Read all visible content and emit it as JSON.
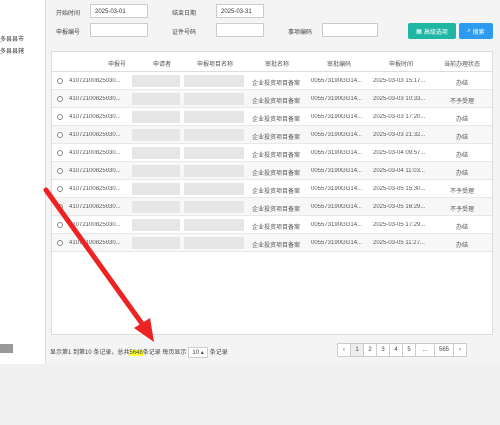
{
  "left_panel": {
    "items": [
      "多县县市",
      "多县县辖"
    ]
  },
  "filters": {
    "start_time_label": "开始时间",
    "start_time_value": "2025-03-01",
    "end_time_label": "结束日期",
    "end_time_value": "2025-03-31",
    "apply_no_label": "申报编号",
    "cert_no_label": "证件号码",
    "item_code_label": "事项编码",
    "advanced_button": "高级选项",
    "search_button": "搜索"
  },
  "table": {
    "headers": [
      "申报号",
      "申请者",
      "申报项目名称",
      "审批名称",
      "审批编码",
      "申报时间",
      "当前办理状态"
    ],
    "rows": [
      {
        "no": "41072100825030...",
        "approval": "企业投资项目备案",
        "code": "005573190GG14...",
        "time": "2025-03-03 15:17...",
        "status": "办结"
      },
      {
        "no": "41072100825030...",
        "approval": "企业投资项目备案",
        "code": "005573190GG14...",
        "time": "2025-03-03 10:33...",
        "status": "不予受理"
      },
      {
        "no": "41072100825030...",
        "approval": "企业投资项目备案",
        "code": "005573190GG14...",
        "time": "2025-03-03 17:20...",
        "status": "办结"
      },
      {
        "no": "41072100825030...",
        "approval": "企业投资项目备案",
        "code": "005573190GG14...",
        "time": "2025-03-03 21:32...",
        "status": "办结"
      },
      {
        "no": "41072100825030...",
        "approval": "企业投资项目备案",
        "code": "005573190GG14...",
        "time": "2025-03-04 09:57...",
        "status": "办结"
      },
      {
        "no": "41072100825030...",
        "approval": "企业投资项目备案",
        "code": "005573190GG14...",
        "time": "2025-03-04 11:03...",
        "status": "办结"
      },
      {
        "no": "41072100825030...",
        "approval": "企业投资项目备案",
        "code": "005573190GG14...",
        "time": "2025-03-05 15:30...",
        "status": "不予受理"
      },
      {
        "no": "41072100825030...",
        "approval": "企业投资项目备案",
        "code": "005573190GG14...",
        "time": "2025-03-05 16:29...",
        "status": "不予受理"
      },
      {
        "no": "41072100825030...",
        "approval": "企业投资项目备案",
        "code": "005573190GG14...",
        "time": "2025-03-05 17:29...",
        "status": "办结"
      },
      {
        "no": "41072100825030...",
        "approval": "企业投资项目备案",
        "code": "005573190GG14...",
        "time": "2025-03-05 11:27...",
        "status": "办结"
      }
    ]
  },
  "pager": {
    "text_prefix": "显示第1 到第10 条记录，总共",
    "total": "5648",
    "text_mid": "条记录 每页显示",
    "page_size": "10",
    "text_suffix": "条记录",
    "prev": "‹",
    "pages": [
      "1",
      "2",
      "3",
      "4",
      "5",
      "...",
      "565"
    ],
    "next": "›"
  },
  "colors": {
    "advanced": "#1fb7a4",
    "search": "#2d9bf0",
    "highlight": "#ffff33",
    "arrow": "#ee2222"
  }
}
